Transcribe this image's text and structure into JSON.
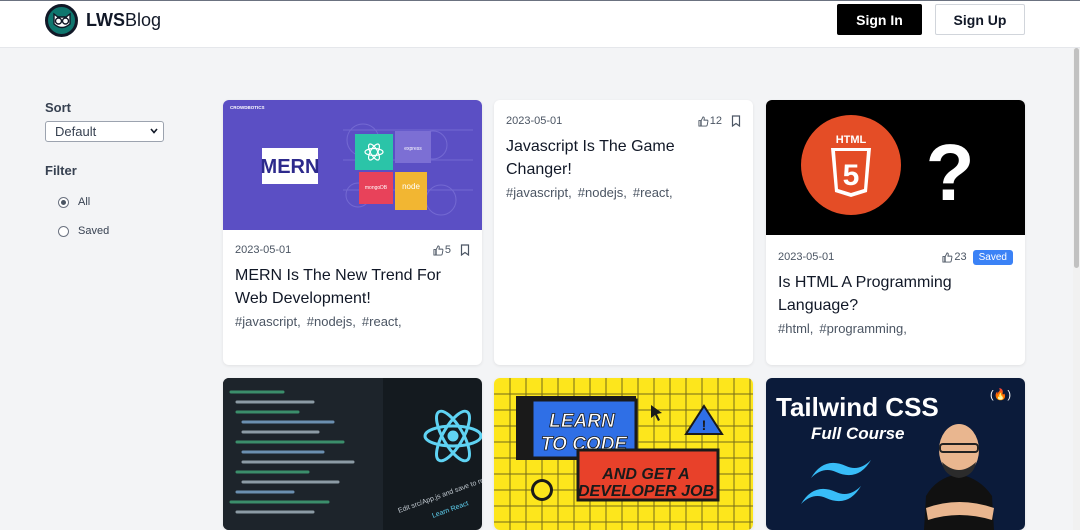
{
  "brand": {
    "name_bold": "LWS",
    "name_rest": "Blog"
  },
  "nav": {
    "signin_label": "Sign In",
    "signup_label": "Sign Up"
  },
  "sidebar": {
    "sort_heading": "Sort",
    "sort_value": "Default",
    "filter_heading": "Filter",
    "filter_options": [
      {
        "label": "All",
        "checked": true
      },
      {
        "label": "Saved",
        "checked": false
      }
    ]
  },
  "posts": [
    {
      "date": "2023-05-01",
      "likes": "5",
      "title": "MERN Is The New Trend For Web Development!",
      "tags": [
        "#javascript,",
        "#nodejs,",
        "#react,"
      ],
      "thumb": {
        "label": "MERN",
        "brand": "CROWDBOTICS",
        "pieces": [
          "express",
          "mongoDB",
          "node"
        ]
      }
    },
    {
      "date": "2023-05-01",
      "likes": "12",
      "title": "Javascript Is The Game Changer!",
      "tags": [
        "#javascript,",
        "#nodejs,",
        "#react,"
      ]
    },
    {
      "date": "2023-05-01",
      "likes": "23",
      "saved_label": "Saved",
      "title": "Is HTML A Programming Language?",
      "tags": [
        "#html,",
        "#programming,"
      ],
      "thumb": {
        "badge_text": "HTML",
        "number": "5",
        "mark": "?"
      }
    },
    {
      "thumb": {
        "caption": "Edit src/App.js and save to re",
        "link": "Learn React"
      }
    },
    {
      "thumb": {
        "line1": "LEARN",
        "line2": "TO CODE",
        "line3": "AND GET A",
        "line4": "DEVELOPER JOB"
      }
    },
    {
      "thumb": {
        "title": "Tailwind CSS",
        "subtitle": "Full Course",
        "corner": "(🔥)"
      }
    }
  ],
  "colors": {
    "signin_bg": "#000000",
    "saved_badge": "#3b82f6",
    "mern_bg": "#5b4fc4",
    "html_bg": "#000000",
    "learn_bg": "#fde61c",
    "tailwind_bg": "#0b1b3a"
  }
}
